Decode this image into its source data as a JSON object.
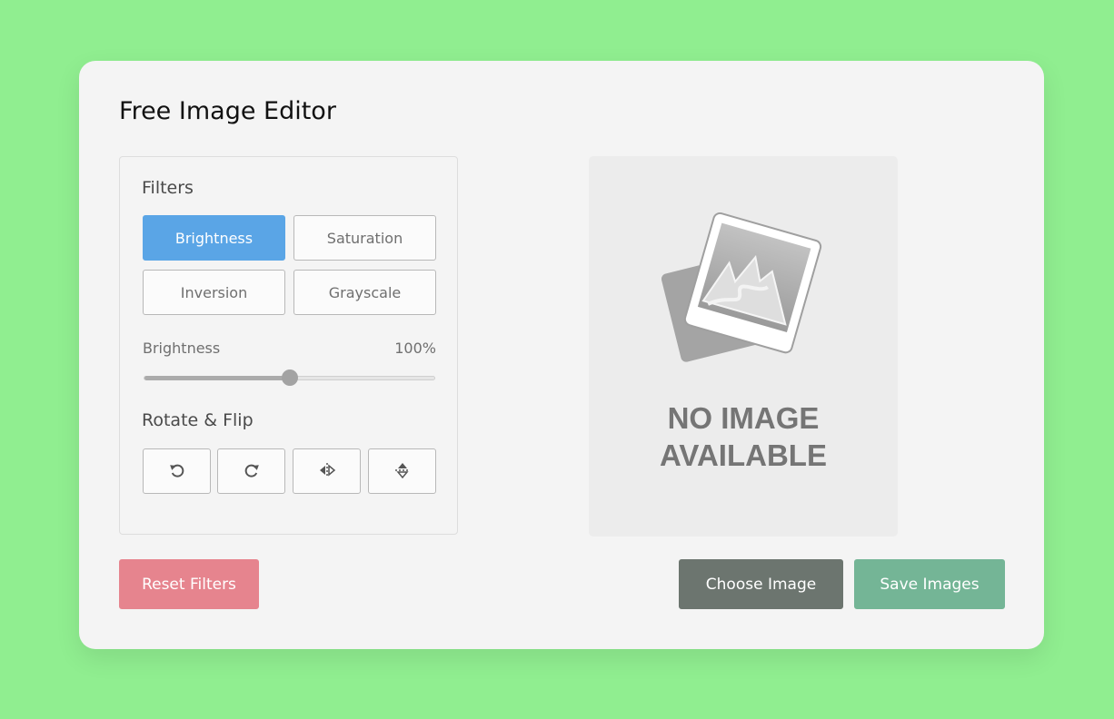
{
  "app": {
    "title": "Free Image Editor"
  },
  "filters": {
    "heading": "Filters",
    "buttons": [
      {
        "label": "Brightness",
        "active": true
      },
      {
        "label": "Saturation",
        "active": false
      },
      {
        "label": "Inversion",
        "active": false
      },
      {
        "label": "Grayscale",
        "active": false
      }
    ],
    "slider": {
      "name": "Brightness",
      "value_text": "100%",
      "level": 0.5
    }
  },
  "rotate_flip": {
    "heading": "Rotate & Flip",
    "buttons": [
      "rotate-left-icon",
      "rotate-right-icon",
      "flip-horizontal-icon",
      "flip-vertical-icon"
    ]
  },
  "preview": {
    "placeholder_line1": "NO IMAGE",
    "placeholder_line2": "AVAILABLE"
  },
  "actions": {
    "reset": "Reset Filters",
    "choose": "Choose Image",
    "save": "Save Images"
  },
  "colors": {
    "background": "#90ee90",
    "active_filter": "#5aa5e6",
    "reset": "#e6848e",
    "choose": "#6c756f",
    "save": "#74b596"
  }
}
